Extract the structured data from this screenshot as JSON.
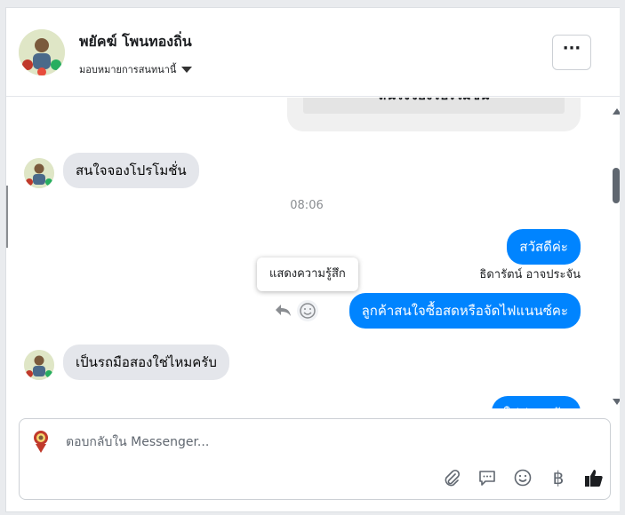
{
  "header": {
    "contact_name": "พยัคฆ์ โพนทองถิ่น",
    "assign_label": "มอบหมายการสนทนานี้",
    "more_label": "···"
  },
  "conversation": {
    "previous_card_text": "สนใจจองโปรโมชั่น",
    "messages": [
      {
        "direction": "incoming",
        "text": "สนใจจองโปรโมชั่น"
      },
      {
        "direction": "outgoing",
        "text": "สวัสดีค่ะ"
      },
      {
        "direction": "outgoing",
        "text": "ลูกค้าสนใจซื้อสดหรือจัดไฟแนนซ์คะ"
      },
      {
        "direction": "incoming",
        "text": "เป็นรถมือสองใช่ไหมครับ"
      },
      {
        "direction": "outgoing",
        "text": "ใช่ค่ะลูกค้า"
      }
    ],
    "timestamp": "08:06",
    "sender_name": "ธิดารัตน์ อาจประจัน",
    "tooltip": "แสดงความรู้สึก"
  },
  "composer": {
    "placeholder": "ตอบกลับใน Messenger...",
    "value": "",
    "tools": [
      "paperclip-icon",
      "saved-reply-icon",
      "emoji-icon",
      "baht-icon",
      "thumbs-up-icon"
    ],
    "baht_symbol": "฿"
  },
  "colors": {
    "outgoing_bubble": "#0084ff",
    "incoming_bubble": "#e4e6eb",
    "panel_background": "#ffffff",
    "page_background": "#e9ebee"
  }
}
